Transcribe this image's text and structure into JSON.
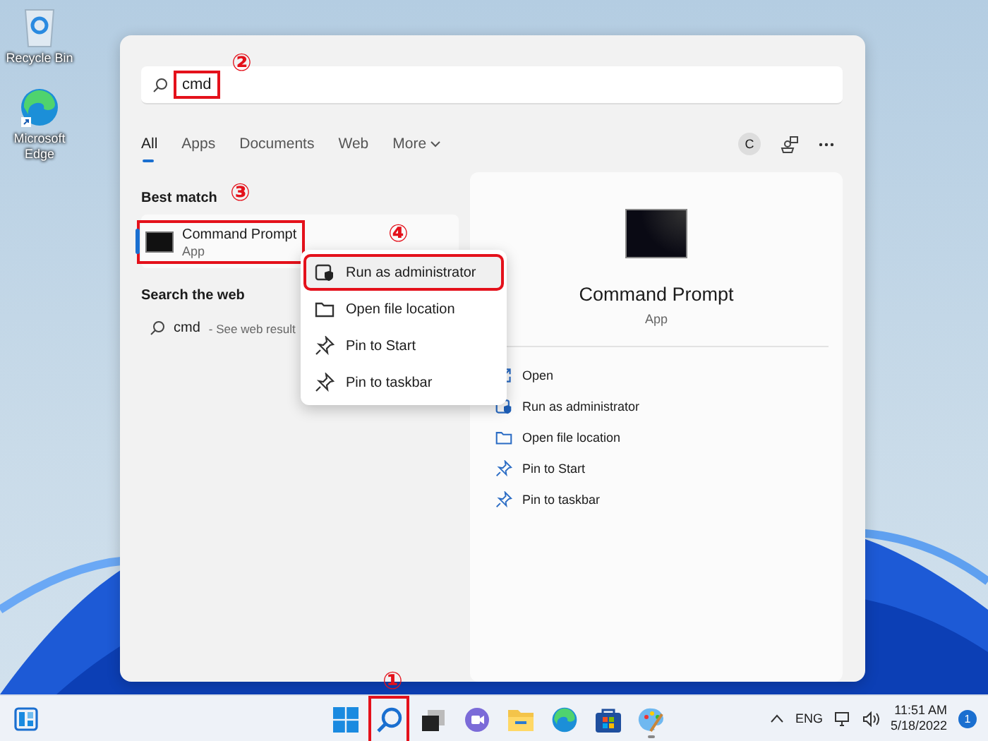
{
  "desktop_icons": [
    {
      "kind": "recycle",
      "label": "Recycle Bin"
    },
    {
      "kind": "edge",
      "label": "Microsoft Edge"
    }
  ],
  "search": {
    "value": "cmd",
    "highlighted": true,
    "callout": "②"
  },
  "tabs": [
    {
      "label": "All",
      "selected": true,
      "kind": "tab"
    },
    {
      "label": "Apps",
      "selected": false,
      "kind": "tab"
    },
    {
      "label": "Documents",
      "selected": false,
      "kind": "tab"
    },
    {
      "label": "Web",
      "selected": false,
      "kind": "tab"
    },
    {
      "label": "More",
      "selected": false,
      "kind": "dropdown"
    }
  ],
  "account_initial": "C",
  "best_match": {
    "heading": "Best match",
    "callout": "③",
    "title": "Command Prompt",
    "subtitle": "App",
    "selected": true,
    "highlighted": true
  },
  "web": {
    "heading": "Search the web",
    "query": "cmd",
    "hint": "- See web result"
  },
  "context_menu": {
    "callout": "④",
    "items": [
      {
        "label": "Run as administrator",
        "kind": "shield",
        "hovered": true,
        "highlighted": true
      },
      {
        "label": "Open file location",
        "kind": "folder",
        "hovered": false,
        "highlighted": false
      },
      {
        "label": "Pin to Start",
        "kind": "pin",
        "hovered": false,
        "highlighted": false
      },
      {
        "label": "Pin to taskbar",
        "kind": "pin",
        "hovered": false,
        "highlighted": false
      }
    ]
  },
  "details": {
    "title": "Command Prompt",
    "subtitle": "App",
    "actions": [
      {
        "label": "Open",
        "kind": "open"
      },
      {
        "label": "Run as administrator",
        "kind": "shield"
      },
      {
        "label": "Open file location",
        "kind": "folder"
      },
      {
        "label": "Pin to Start",
        "kind": "pin"
      },
      {
        "label": "Pin to taskbar",
        "kind": "pin"
      }
    ]
  },
  "taskbar": {
    "apps": [
      {
        "kind": "start",
        "running": false,
        "highlighted": false
      },
      {
        "kind": "search",
        "running": false,
        "highlighted": true,
        "callout": "①"
      },
      {
        "kind": "taskview",
        "running": false,
        "highlighted": false
      },
      {
        "kind": "chat",
        "running": false,
        "highlighted": false
      },
      {
        "kind": "explorer",
        "running": false,
        "highlighted": false
      },
      {
        "kind": "edge",
        "running": false,
        "highlighted": false
      },
      {
        "kind": "store",
        "running": false,
        "highlighted": false
      },
      {
        "kind": "paint",
        "running": true,
        "highlighted": false
      }
    ],
    "language": "ENG",
    "time": "11:51 AM",
    "date": "5/18/2022",
    "notifications": "1"
  }
}
